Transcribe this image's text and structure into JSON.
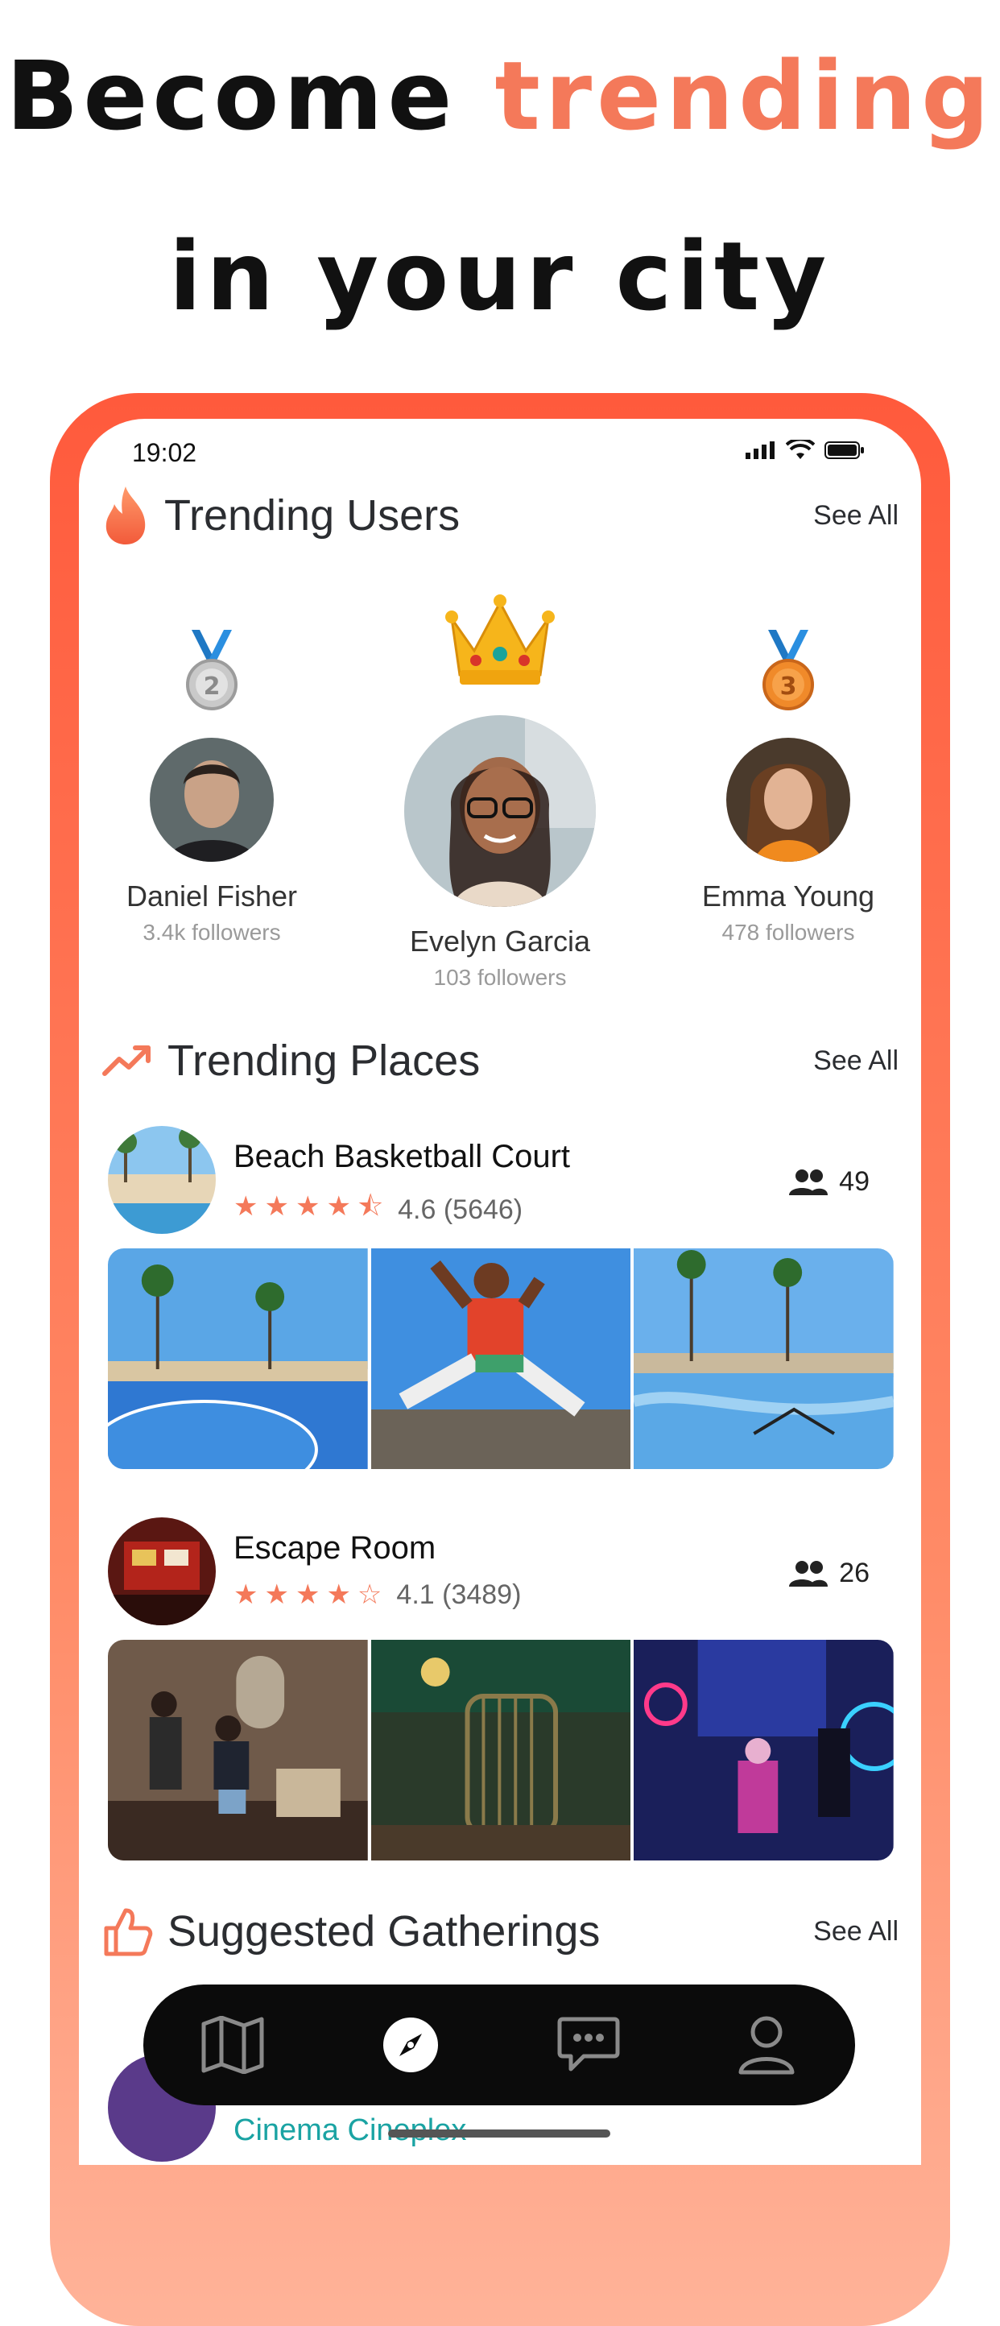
{
  "headline": {
    "line1_a": "Become",
    "line1_b": "trending",
    "line2": "in your city"
  },
  "status": {
    "time": "19:02"
  },
  "trending_users": {
    "title": "Trending Users",
    "see_all": "See All",
    "users": [
      {
        "name": "Daniel Fisher",
        "followers": "3.4k followers",
        "medal": "2"
      },
      {
        "name": "Evelyn Garcia",
        "followers": "103 followers",
        "medal": "crown"
      },
      {
        "name": "Emma Young",
        "followers": "478 followers",
        "medal": "3"
      }
    ]
  },
  "trending_places": {
    "title": "Trending Places",
    "see_all": "See All",
    "places": [
      {
        "name": "Beach Basketball Court",
        "stars": "★★★★⯪",
        "rating": "4.6 (5646)",
        "people": "49"
      },
      {
        "name": "Escape Room",
        "stars": "★★★★☆",
        "rating": "4.1 (3489)",
        "people": "26"
      }
    ]
  },
  "suggested": {
    "title": "Suggested Gatherings",
    "see_all": "See All",
    "peek_label": "Cinema Cineplex"
  },
  "nav": {
    "items": [
      "map-icon",
      "compass-icon",
      "chat-icon",
      "profile-icon"
    ],
    "active": "compass-icon"
  },
  "colors": {
    "accent": "#f4795a",
    "frame_top": "#ff5a3c",
    "frame_bottom": "#ffb399",
    "nav_bg": "#0b0b0b"
  }
}
